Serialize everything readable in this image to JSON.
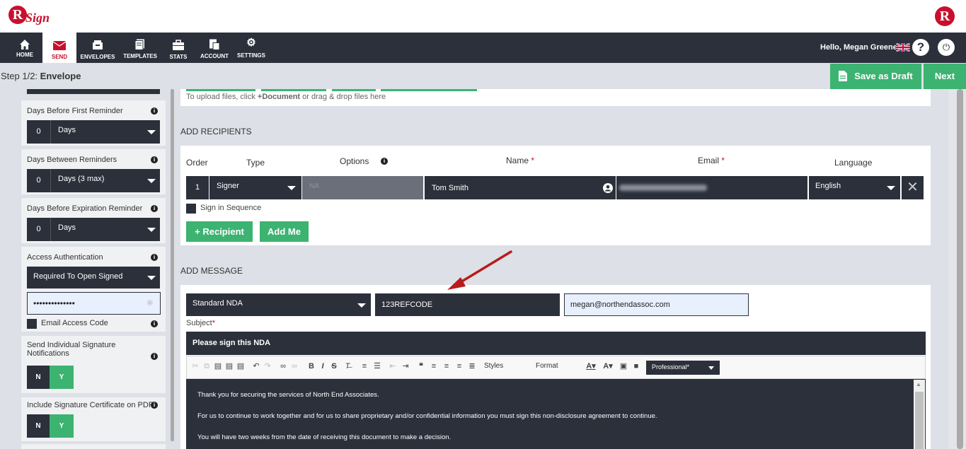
{
  "app": {
    "logo_letter": "R",
    "logo_word": "Sign"
  },
  "nav": {
    "items": [
      {
        "label": "HOME",
        "icon": "home-icon"
      },
      {
        "label": "SEND",
        "icon": "envelope-icon"
      },
      {
        "label": "ENVELOPES",
        "icon": "inbox-icon"
      },
      {
        "label": "TEMPLATES",
        "icon": "templates-icon"
      },
      {
        "label": "STATS",
        "icon": "briefcase-icon"
      },
      {
        "label": "ACCOUNT",
        "icon": "account-icon"
      },
      {
        "label": "SETTINGS",
        "icon": "gear-icon"
      }
    ],
    "greeting": "Hello, Megan Greene"
  },
  "step": {
    "prefix": "Step 1/2:",
    "name": "Envelope"
  },
  "actions": {
    "save_draft": "Save as Draft",
    "next": "Next"
  },
  "sidebar": {
    "first_reminder": {
      "label": "Days Before First Reminder",
      "value": "0",
      "unit": "Days"
    },
    "between_reminders": {
      "label": "Days Between Reminders",
      "value": "0",
      "unit": "Days (3 max)"
    },
    "expiration_reminder": {
      "label": "Days Before Expiration Reminder",
      "value": "0",
      "unit": "Days"
    },
    "access_auth": {
      "label": "Access Authentication",
      "value": "Required To Open Signed",
      "password": "••••••••••••••",
      "email_code_label": "Email Access Code"
    },
    "individual_notifications": {
      "label": "Send Individual Signature Notifications",
      "no": "N",
      "yes": "Y"
    },
    "signature_cert": {
      "label": "Include Signature Certificate on PDF",
      "no": "N",
      "yes": "Y"
    }
  },
  "upload": {
    "hint_prefix": "To upload files, click ",
    "hint_bold": "+Document",
    "hint_suffix": " or drag & drop files here"
  },
  "recipients": {
    "section_title": "ADD RECIPIENTS",
    "columns": {
      "order": "Order",
      "type": "Type",
      "options": "Options",
      "name": "Name",
      "email": "Email",
      "language": "Language",
      "required": "*"
    },
    "row": {
      "order": "1",
      "type": "Signer",
      "options": "NA",
      "name": "Tom Smith",
      "language": "English"
    },
    "sign_in_sequence": "Sign in Sequence",
    "add_recipient": "+ Recipient",
    "add_me": "Add Me"
  },
  "message": {
    "section_title": "ADD MESSAGE",
    "template": "Standard NDA",
    "ref_code": "123REFCODE",
    "sender_email": "megan@northendassoc.com",
    "subject_label": "Subject",
    "subject": "Please sign this NDA",
    "toolbar": {
      "styles": "Styles",
      "format": "Format",
      "theme": "Professional*"
    },
    "body": [
      "Thank you for securing the services of North End Associates.",
      "For us to continue to work together and for us to share proprietary and/or confidential information you must sign this non-disclosure agreement to continue.",
      "You will have two weeks from the date of receiving this document to make a decision."
    ]
  },
  "colors": {
    "brand_red": "#c8102e",
    "nav_dark": "#2b303b",
    "accent_green": "#3cb371",
    "annotation_arrow": "#b71c1c"
  }
}
